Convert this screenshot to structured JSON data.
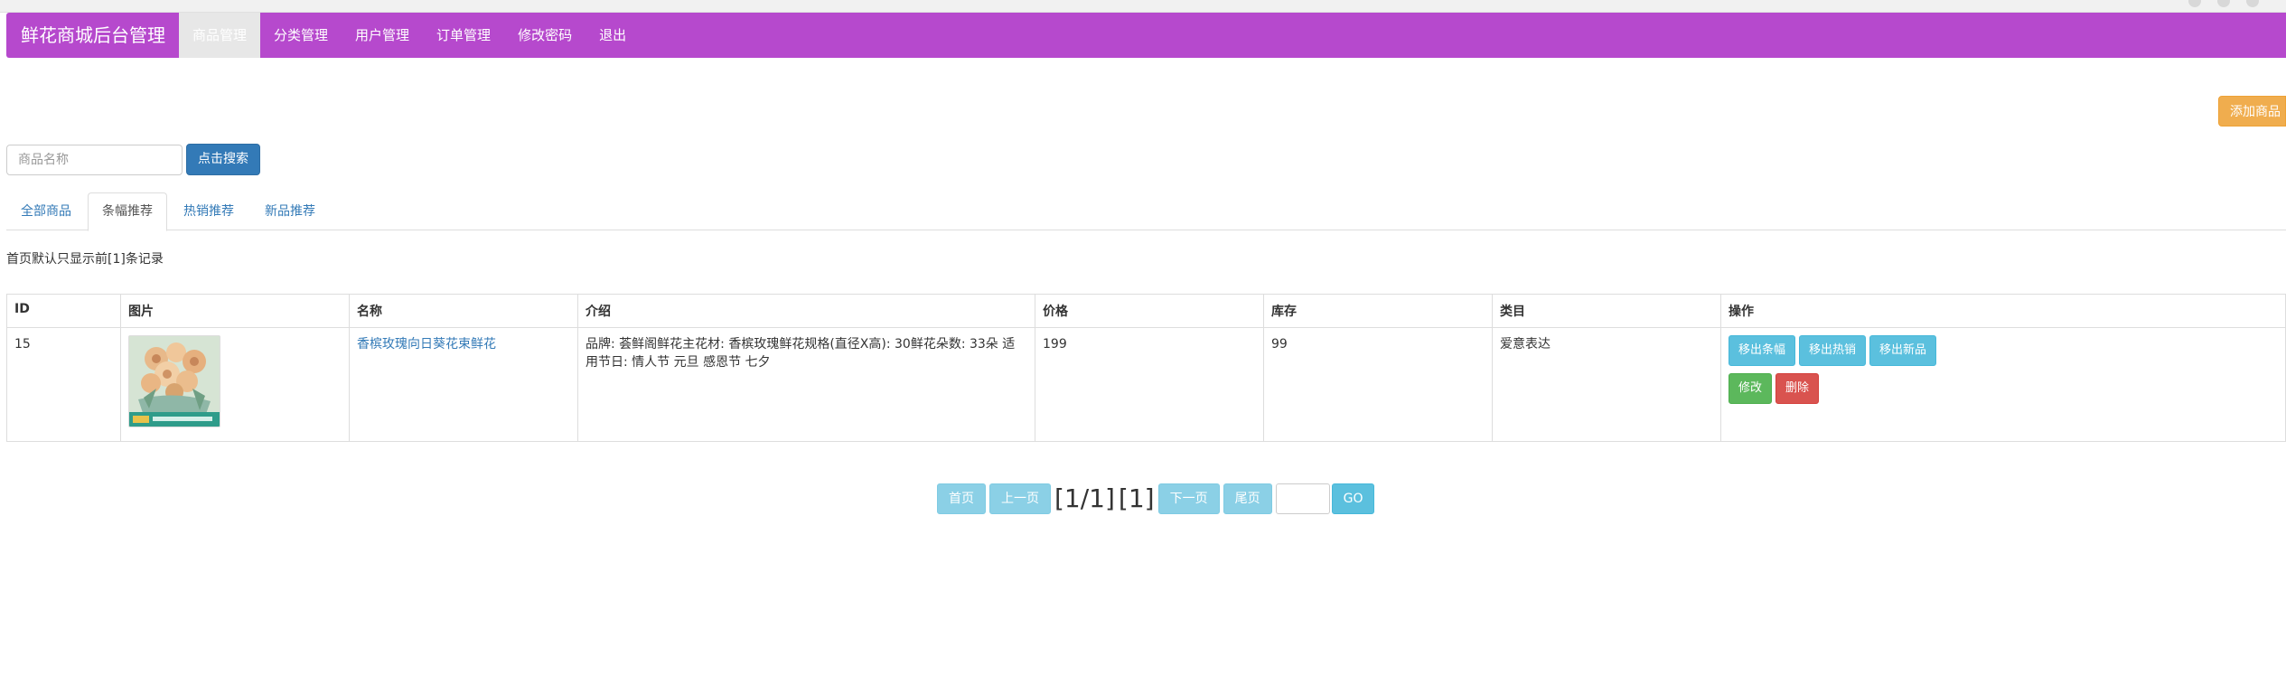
{
  "navbar": {
    "brand": "鲜花商城后台管理",
    "items": [
      {
        "label": "商品管理",
        "active": true
      },
      {
        "label": "分类管理"
      },
      {
        "label": "用户管理"
      },
      {
        "label": "订单管理"
      },
      {
        "label": "修改密码"
      },
      {
        "label": "退出"
      }
    ]
  },
  "toolbar": {
    "add_label": "添加商品"
  },
  "search": {
    "placeholder": "商品名称",
    "value": "",
    "button_label": "点击搜索"
  },
  "tabs": [
    {
      "label": "全部商品"
    },
    {
      "label": "条幅推荐",
      "active": true
    },
    {
      "label": "热销推荐"
    },
    {
      "label": "新品推荐"
    }
  ],
  "note": "首页默认只显示前[1]条记录",
  "table": {
    "headers": [
      "ID",
      "图片",
      "名称",
      "介绍",
      "价格",
      "库存",
      "类目",
      "操作"
    ],
    "rows": [
      {
        "id": "15",
        "image_icon": "flower-bouquet-thumbnail",
        "name": "香槟玫瑰向日葵花束鲜花",
        "intro": "品牌: 荟鲜阁鲜花主花材: 香槟玫瑰鲜花规格(直径X高): 30鲜花朵数: 33朵 适用节日: 情人节 元旦 感恩节 七夕",
        "price": "199",
        "stock": "99",
        "category": "爱意表达",
        "actions": {
          "remove_banner": "移出条幅",
          "remove_hot": "移出热销",
          "remove_new": "移出新品",
          "edit": "修改",
          "delete": "删除"
        }
      }
    ]
  },
  "pagination": {
    "first": "首页",
    "prev": "上一页",
    "info": "[1/1]",
    "total": "[1]",
    "next": "下一页",
    "last": "尾页",
    "goto_value": "",
    "go": "GO"
  },
  "colors": {
    "navbar": "#b649cd",
    "primary": "#337ab7",
    "warning": "#f0ad4e",
    "info": "#5bc0de",
    "success": "#5cb85c",
    "danger": "#d9534f"
  }
}
